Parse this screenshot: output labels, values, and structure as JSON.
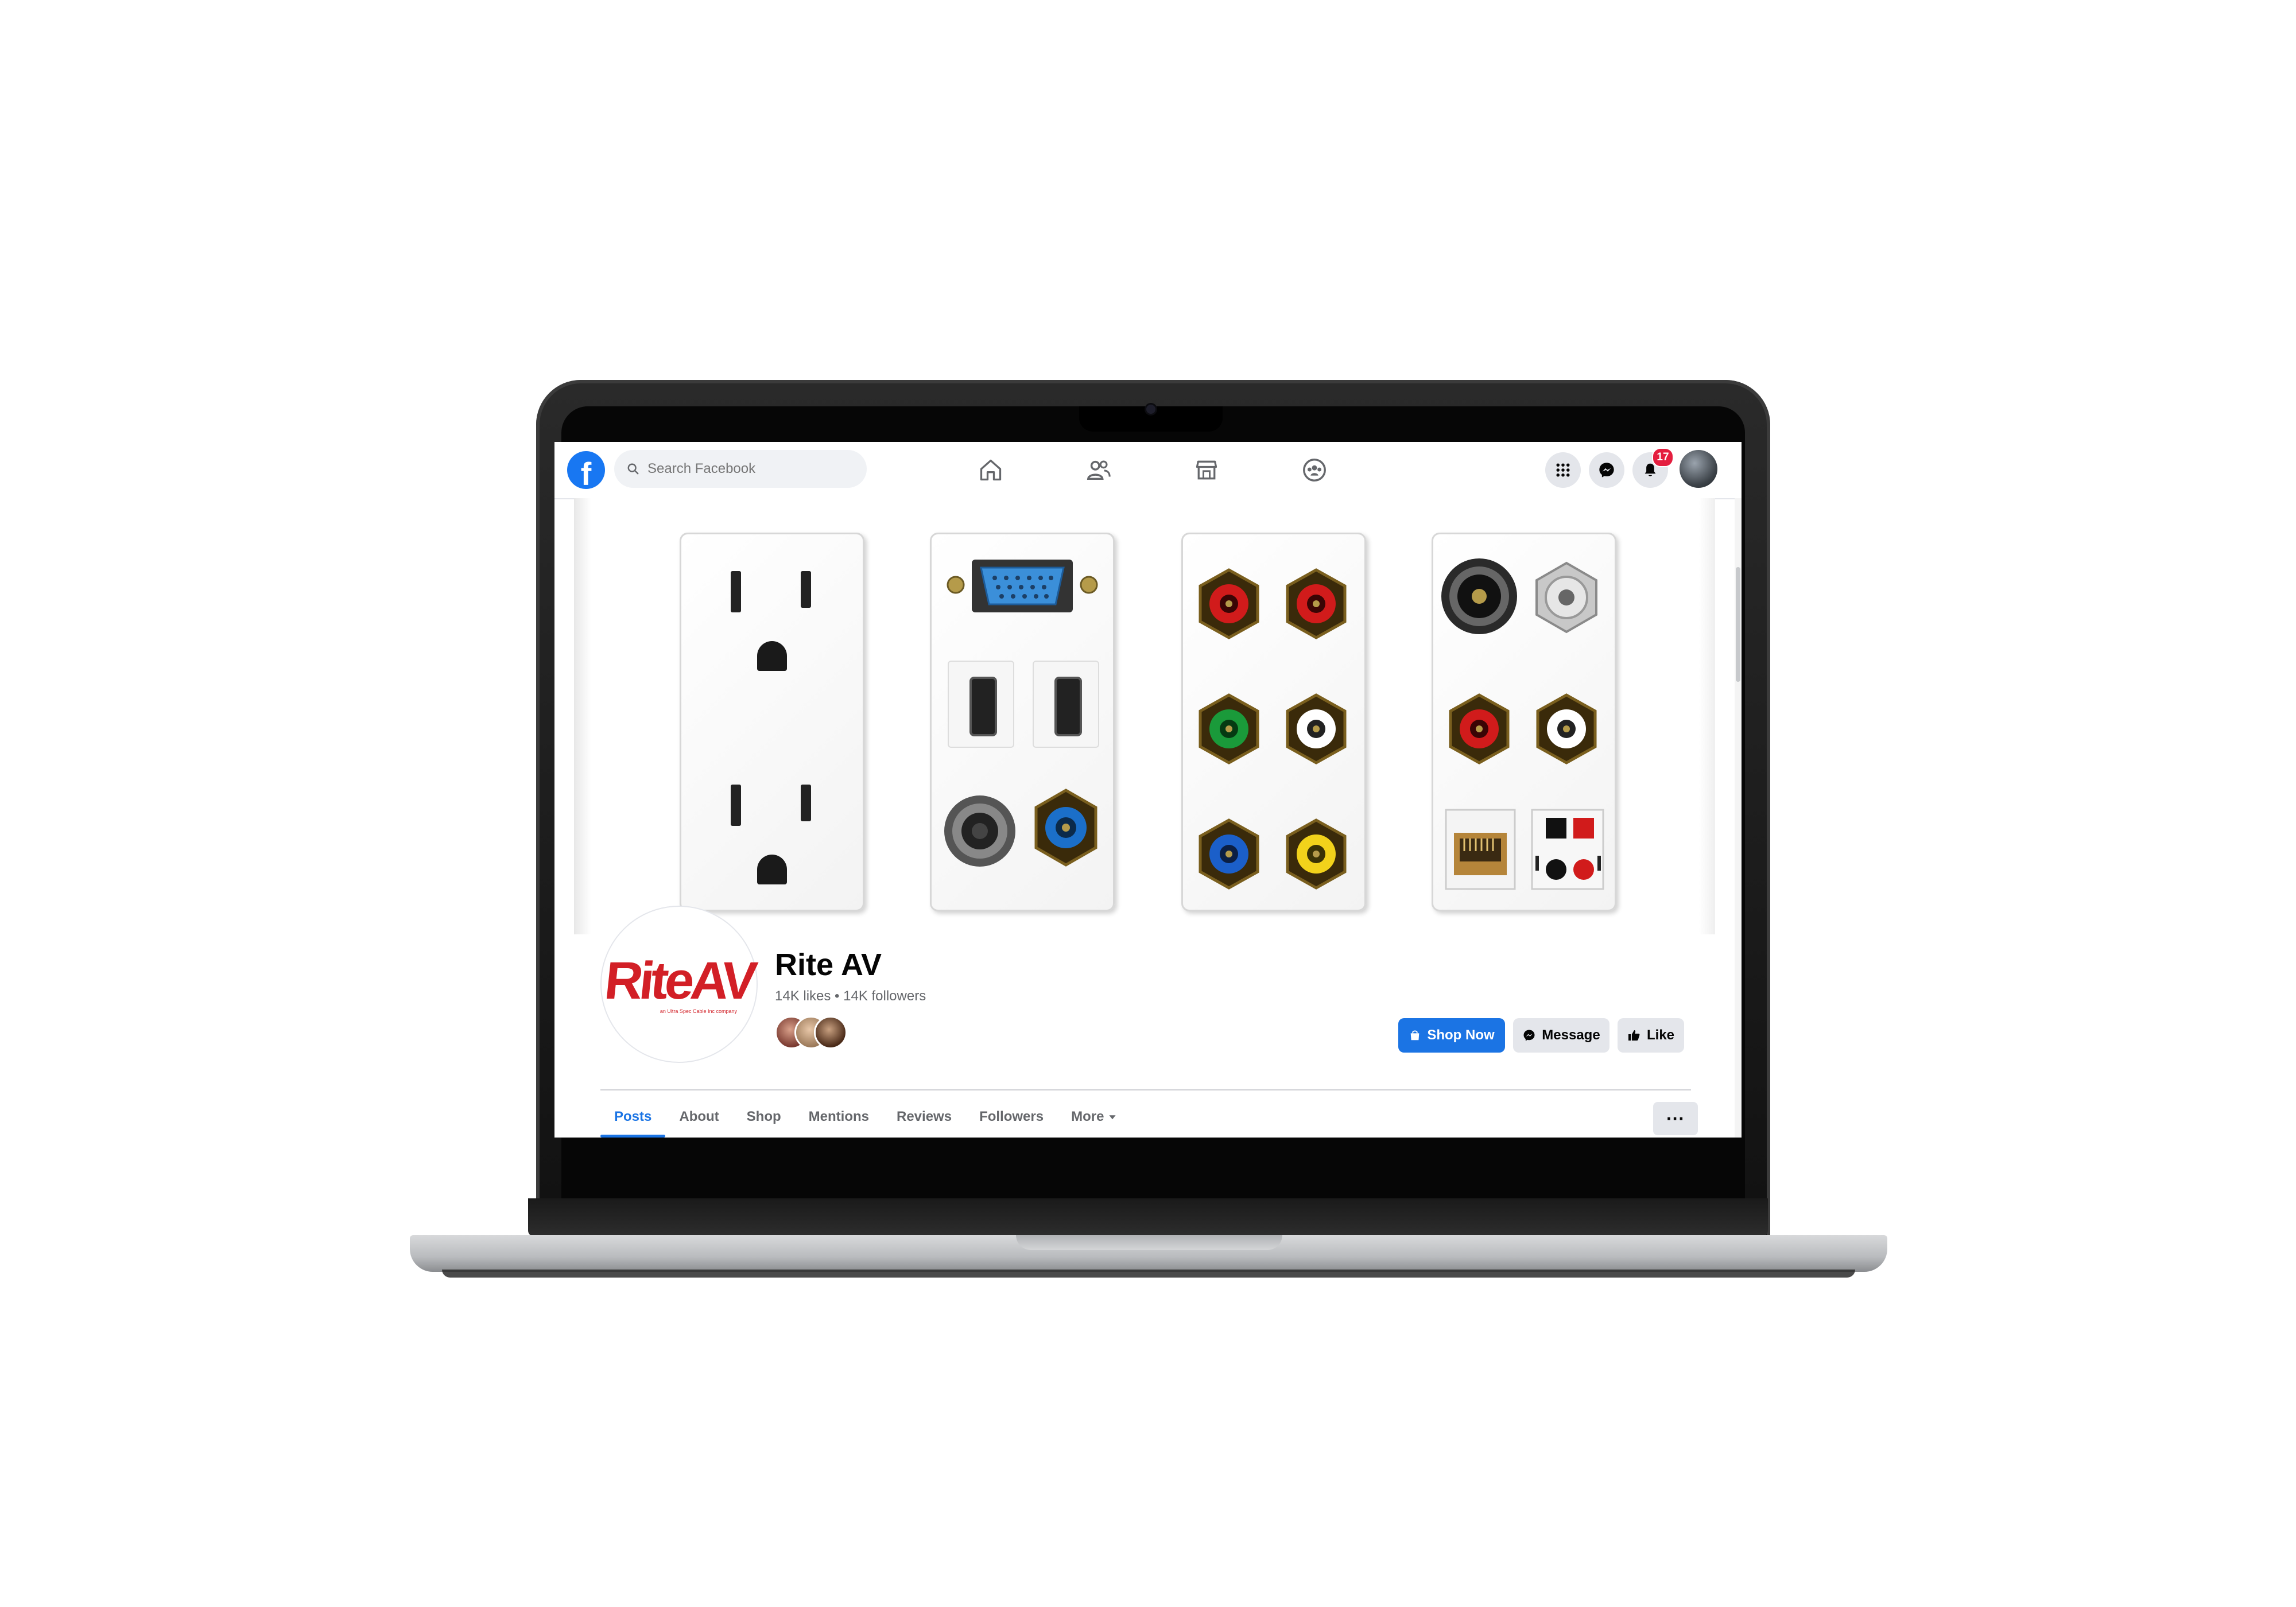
{
  "header": {
    "logo_icon": "facebook-logo-icon",
    "logo_glyph": "f",
    "search_placeholder": "Search Facebook",
    "nav_icons": [
      "home-icon",
      "friends-icon",
      "marketplace-icon",
      "groups-icon"
    ],
    "right_icons": [
      "menu-grid-icon",
      "messenger-icon",
      "notifications-bell-icon"
    ],
    "notification_count": "17"
  },
  "page": {
    "name": "Rite AV",
    "stats": "14K likes • 14K followers",
    "logo_text": "RiteAV",
    "logo_subtext": "an Ultra Spec Cable Inc company",
    "actions": {
      "shop_now": "Shop Now",
      "message": "Message",
      "like": "Like"
    },
    "more_options": "···"
  },
  "tabs": [
    {
      "label": "Posts",
      "active": true
    },
    {
      "label": "About"
    },
    {
      "label": "Shop"
    },
    {
      "label": "Mentions"
    },
    {
      "label": "Reviews"
    },
    {
      "label": "Followers"
    },
    {
      "label": "More"
    }
  ],
  "colors": {
    "facebook_blue": "#1877f2",
    "primary_button": "#1b74e4",
    "secondary_button": "#e4e6eb",
    "brand_red": "#d21f26",
    "badge_red": "#e41e3f"
  }
}
